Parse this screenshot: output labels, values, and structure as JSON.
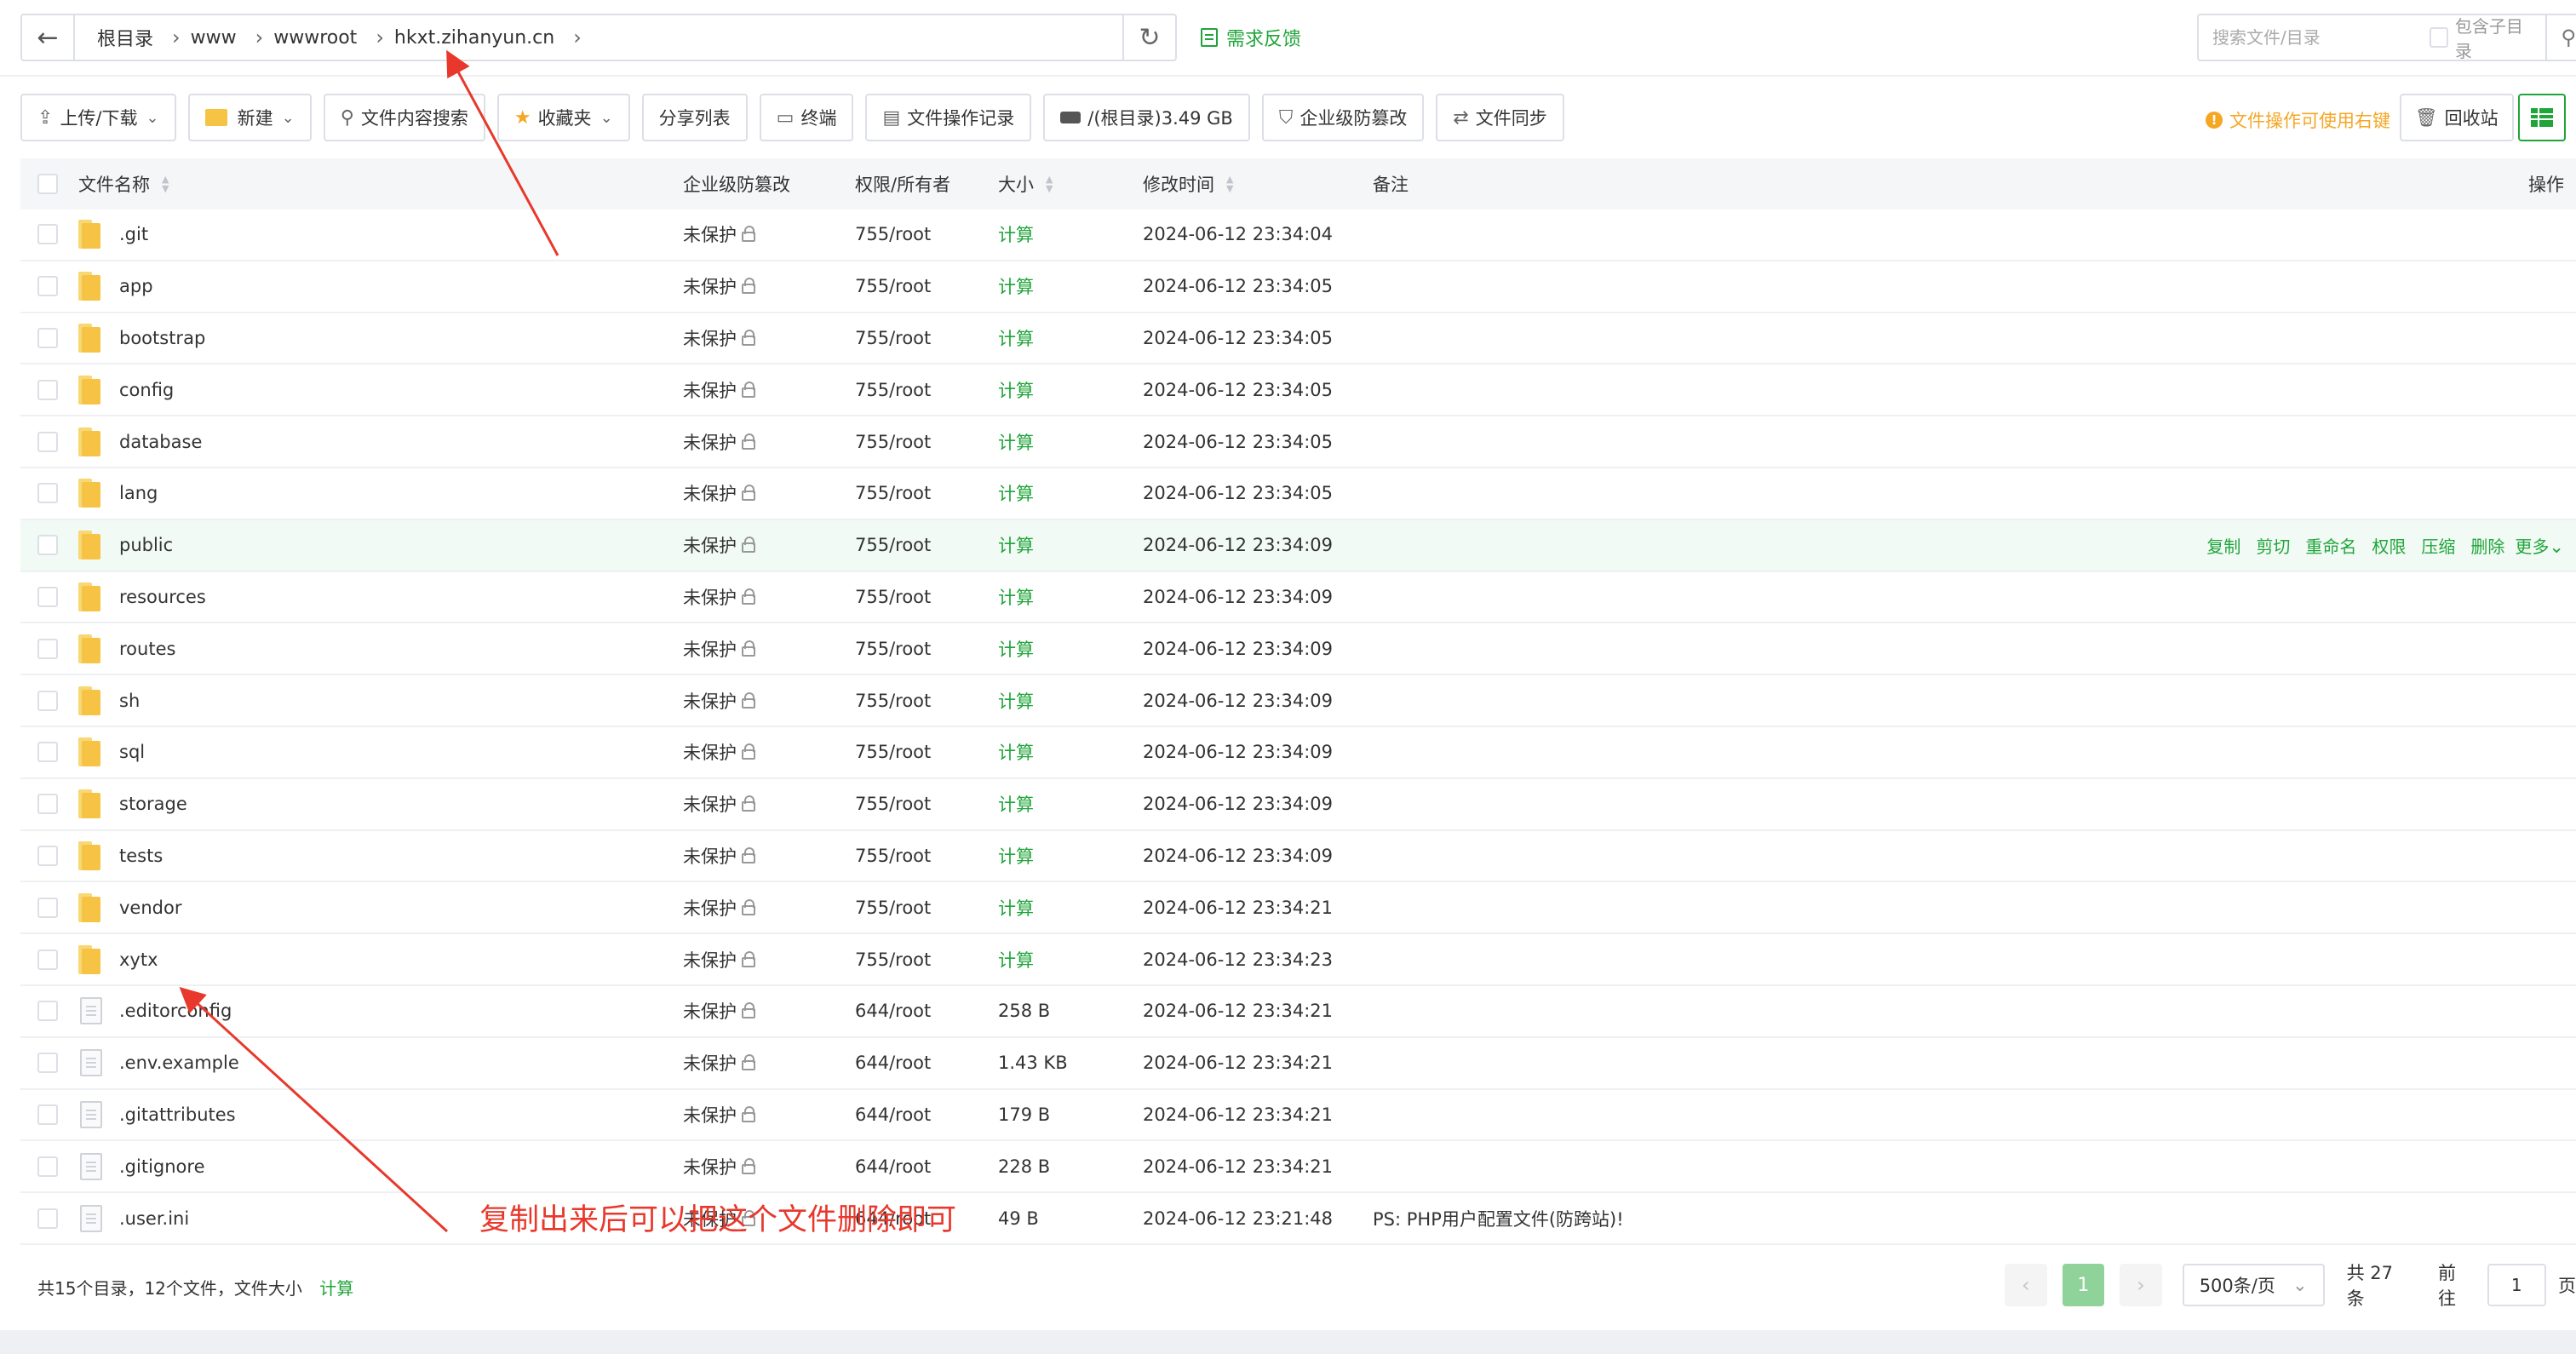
{
  "nav": {
    "back_icon": "arrow-left-icon",
    "breadcrumbs": [
      "根目录",
      "www",
      "wwwroot",
      "hkxt.zihanyun.cn"
    ],
    "refresh_icon": "refresh-icon",
    "feedback_label": "需求反馈"
  },
  "search": {
    "placeholder": "搜索文件/目录",
    "include_sub_label": "包含子目录"
  },
  "toolbar": {
    "upload_label": "上传/下载",
    "new_label": "新建",
    "content_search_label": "文件内容搜索",
    "favorites_label": "收藏夹",
    "share_list_label": "分享列表",
    "terminal_label": "终端",
    "op_log_label": "文件操作记录",
    "disk_label": "/(根目录)3.49 GB",
    "tamper_label": "企业级防篡改",
    "sync_label": "文件同步",
    "hint_text": "文件操作可使用右键",
    "recycle_label": "回收站"
  },
  "table": {
    "headers": {
      "name": "文件名称",
      "protect": "企业级防篡改",
      "perm": "权限/所有者",
      "size": "大小",
      "mtime": "修改时间",
      "note": "备注",
      "ops": "操作"
    },
    "rows": [
      {
        "type": "folder",
        "name": ".git",
        "protect": "未保护",
        "perm": "755/root",
        "size": "计算",
        "mtime": "2024-06-12 23:34:04",
        "note": ""
      },
      {
        "type": "folder",
        "name": "app",
        "protect": "未保护",
        "perm": "755/root",
        "size": "计算",
        "mtime": "2024-06-12 23:34:05",
        "note": ""
      },
      {
        "type": "folder",
        "name": "bootstrap",
        "protect": "未保护",
        "perm": "755/root",
        "size": "计算",
        "mtime": "2024-06-12 23:34:05",
        "note": ""
      },
      {
        "type": "folder",
        "name": "config",
        "protect": "未保护",
        "perm": "755/root",
        "size": "计算",
        "mtime": "2024-06-12 23:34:05",
        "note": ""
      },
      {
        "type": "folder",
        "name": "database",
        "protect": "未保护",
        "perm": "755/root",
        "size": "计算",
        "mtime": "2024-06-12 23:34:05",
        "note": ""
      },
      {
        "type": "folder",
        "name": "lang",
        "protect": "未保护",
        "perm": "755/root",
        "size": "计算",
        "mtime": "2024-06-12 23:34:05",
        "note": ""
      },
      {
        "type": "folder",
        "name": "public",
        "protect": "未保护",
        "perm": "755/root",
        "size": "计算",
        "mtime": "2024-06-12 23:34:09",
        "note": "",
        "hover": true
      },
      {
        "type": "folder",
        "name": "resources",
        "protect": "未保护",
        "perm": "755/root",
        "size": "计算",
        "mtime": "2024-06-12 23:34:09",
        "note": ""
      },
      {
        "type": "folder",
        "name": "routes",
        "protect": "未保护",
        "perm": "755/root",
        "size": "计算",
        "mtime": "2024-06-12 23:34:09",
        "note": ""
      },
      {
        "type": "folder",
        "name": "sh",
        "protect": "未保护",
        "perm": "755/root",
        "size": "计算",
        "mtime": "2024-06-12 23:34:09",
        "note": ""
      },
      {
        "type": "folder",
        "name": "sql",
        "protect": "未保护",
        "perm": "755/root",
        "size": "计算",
        "mtime": "2024-06-12 23:34:09",
        "note": ""
      },
      {
        "type": "folder",
        "name": "storage",
        "protect": "未保护",
        "perm": "755/root",
        "size": "计算",
        "mtime": "2024-06-12 23:34:09",
        "note": ""
      },
      {
        "type": "folder",
        "name": "tests",
        "protect": "未保护",
        "perm": "755/root",
        "size": "计算",
        "mtime": "2024-06-12 23:34:09",
        "note": ""
      },
      {
        "type": "folder",
        "name": "vendor",
        "protect": "未保护",
        "perm": "755/root",
        "size": "计算",
        "mtime": "2024-06-12 23:34:21",
        "note": ""
      },
      {
        "type": "folder",
        "name": "xytx",
        "protect": "未保护",
        "perm": "755/root",
        "size": "计算",
        "mtime": "2024-06-12 23:34:23",
        "note": ""
      },
      {
        "type": "file",
        "name": ".editorconfig",
        "protect": "未保护",
        "perm": "644/root",
        "size": "258 B",
        "mtime": "2024-06-12 23:34:21",
        "note": ""
      },
      {
        "type": "file",
        "name": ".env.example",
        "protect": "未保护",
        "perm": "644/root",
        "size": "1.43 KB",
        "mtime": "2024-06-12 23:34:21",
        "note": ""
      },
      {
        "type": "file",
        "name": ".gitattributes",
        "protect": "未保护",
        "perm": "644/root",
        "size": "179 B",
        "mtime": "2024-06-12 23:34:21",
        "note": ""
      },
      {
        "type": "file",
        "name": ".gitignore",
        "protect": "未保护",
        "perm": "644/root",
        "size": "228 B",
        "mtime": "2024-06-12 23:34:21",
        "note": ""
      },
      {
        "type": "file",
        "name": ".user.ini",
        "protect": "未保护",
        "perm": "644/root",
        "size": "49 B",
        "mtime": "2024-06-12 23:21:48",
        "note": "PS: PHP用户配置文件(防跨站)!"
      }
    ],
    "row_actions": [
      "复制",
      "剪切",
      "重命名",
      "权限",
      "压缩",
      "删除",
      "更多"
    ]
  },
  "footer": {
    "summary": "共15个目录，12个文件，文件大小",
    "calc_link": "计算",
    "current_page": "1",
    "per_page": "500条/页",
    "total": "共 27 条",
    "goto_label": "前往",
    "goto_value": "1",
    "page_suffix": "页"
  },
  "annotation": {
    "text": "复制出来后可以把这个文件删除即可",
    "color": "#e8382c"
  },
  "colors": {
    "accent": "#20a53a",
    "warning": "#f5a623",
    "folder": "#f6c344"
  }
}
